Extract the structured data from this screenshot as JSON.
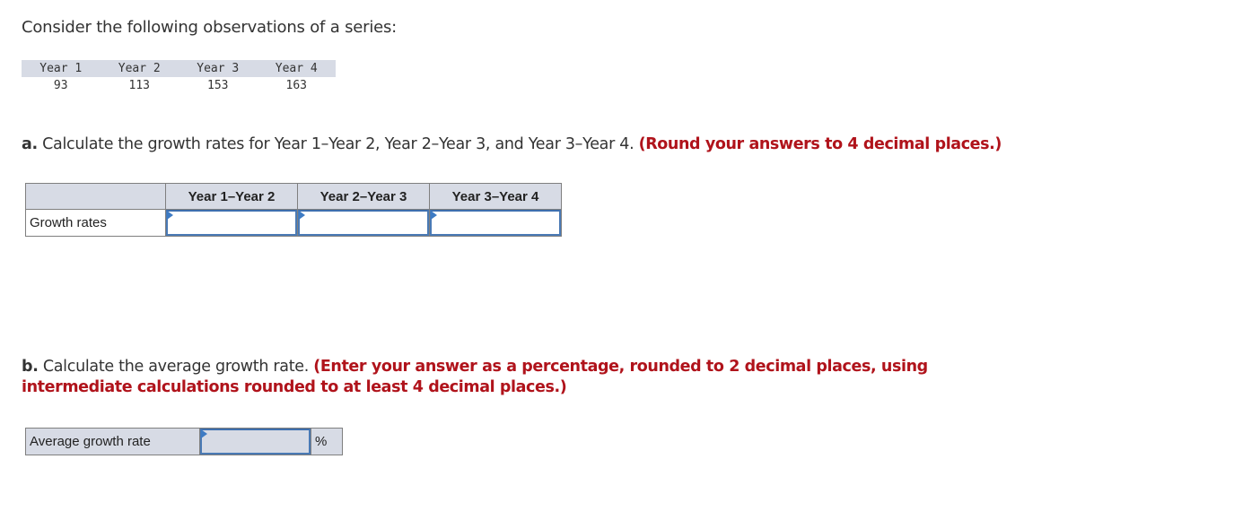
{
  "intro": "Consider the following observations of a series:",
  "observations": {
    "headers": [
      "Year 1",
      "Year 2",
      "Year 3",
      "Year 4"
    ],
    "values": [
      "93",
      "113",
      "153",
      "163"
    ]
  },
  "part_a": {
    "label": "a.",
    "text": " Calculate the growth rates for Year 1–Year 2, Year 2–Year 3, and Year 3–Year 4. ",
    "note": "(Round your answers to 4 decimal places.)",
    "table": {
      "columns": [
        "Year 1–Year 2",
        "Year 2–Year 3",
        "Year 3–Year 4"
      ],
      "row_label": "Growth rates",
      "values": [
        "",
        "",
        ""
      ]
    }
  },
  "part_b": {
    "label": "b.",
    "text": " Calculate the average growth rate. ",
    "note": "(Enter your answer as a percentage, rounded to 2 decimal places, using intermediate calculations rounded to at least 4 decimal places.)",
    "row_label": "Average growth rate",
    "value": "",
    "unit": "%"
  },
  "colors": {
    "instruction_red": "#b0131b",
    "header_bg": "#d7dbe5",
    "input_border": "#4a7ab5"
  }
}
